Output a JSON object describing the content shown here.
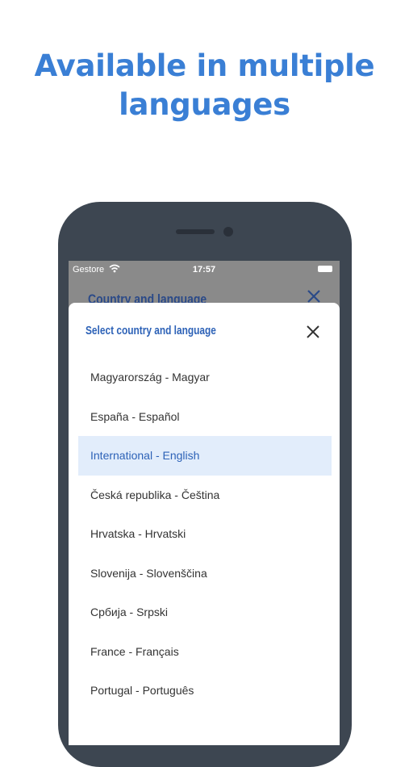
{
  "headline": {
    "line1": "Available in multiple",
    "line2": "languages"
  },
  "status_bar": {
    "carrier": "Gestore",
    "time": "17:57"
  },
  "background_screen": {
    "title": "Country and language"
  },
  "sheet": {
    "title": "Select country and language",
    "selected_index": 2,
    "items": [
      {
        "label": "Magyarország - Magyar"
      },
      {
        "label": "España - Español"
      },
      {
        "label": "International - English"
      },
      {
        "label": "Česká republika - Čeština"
      },
      {
        "label": "Hrvatska - Hrvatski"
      },
      {
        "label": "Slovenija - Slovenščina"
      },
      {
        "label": "Србија - Srpski"
      },
      {
        "label": "France - Français"
      },
      {
        "label": "Portugal - Português"
      }
    ]
  },
  "colors": {
    "accent": "#3a7fd5",
    "selected_bg": "#e2edfb",
    "phone_frame": "#3d4651",
    "sheet_title": "#2d62b7"
  },
  "icons": {
    "wifi": "wifi-icon",
    "battery": "battery-icon",
    "close": "close-icon"
  }
}
